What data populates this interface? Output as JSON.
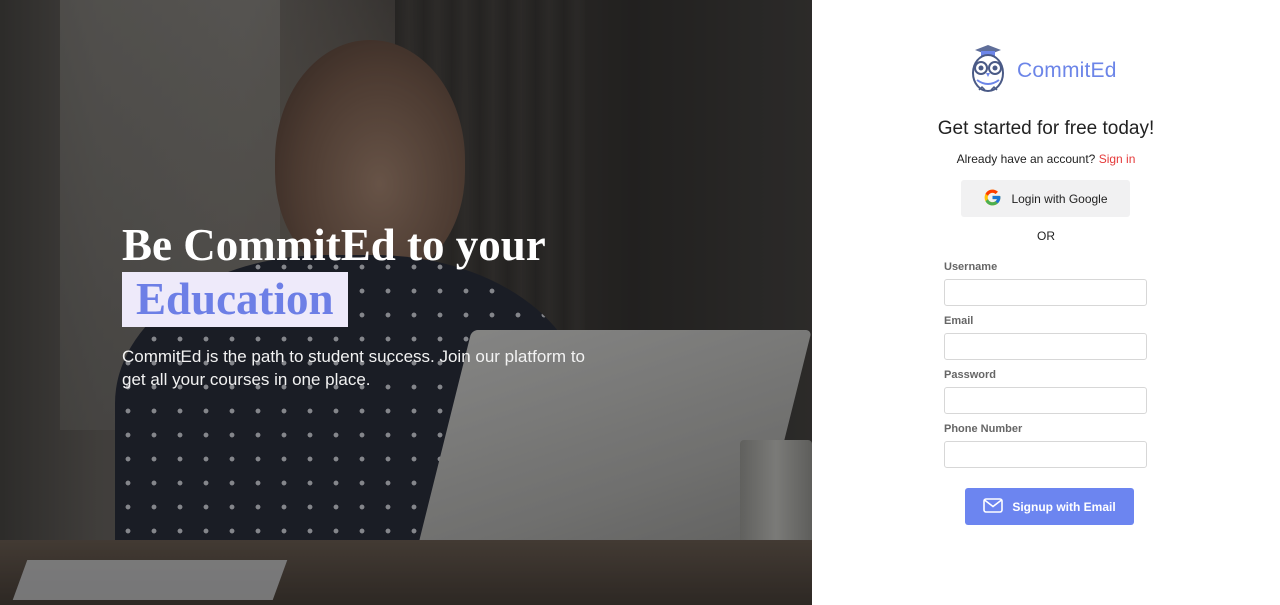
{
  "hero": {
    "title_line1": "Be CommitEd to your",
    "title_highlight": "Education",
    "subtitle": "CommitEd is the path to student success. Join our platform to get all your courses in one place."
  },
  "brand": {
    "name": "CommitEd",
    "logo_icon": "owl-graduate-icon"
  },
  "form": {
    "heading": "Get started for free today!",
    "signin_prompt": "Already have an account?",
    "signin_link": "Sign in",
    "google_button": "Login with Google",
    "or_text": "OR",
    "fields": [
      {
        "label": "Username",
        "value": "",
        "placeholder": ""
      },
      {
        "label": "Email",
        "value": "",
        "placeholder": ""
      },
      {
        "label": "Password",
        "value": "",
        "placeholder": ""
      },
      {
        "label": "Phone Number",
        "value": "",
        "placeholder": ""
      }
    ],
    "email_button": "Signup with Email"
  },
  "colors": {
    "accent": "#6c85f0",
    "brand_text": "#6c85e8",
    "signin_link": "#e53a3a",
    "highlight_bg": "#eeeafa"
  }
}
